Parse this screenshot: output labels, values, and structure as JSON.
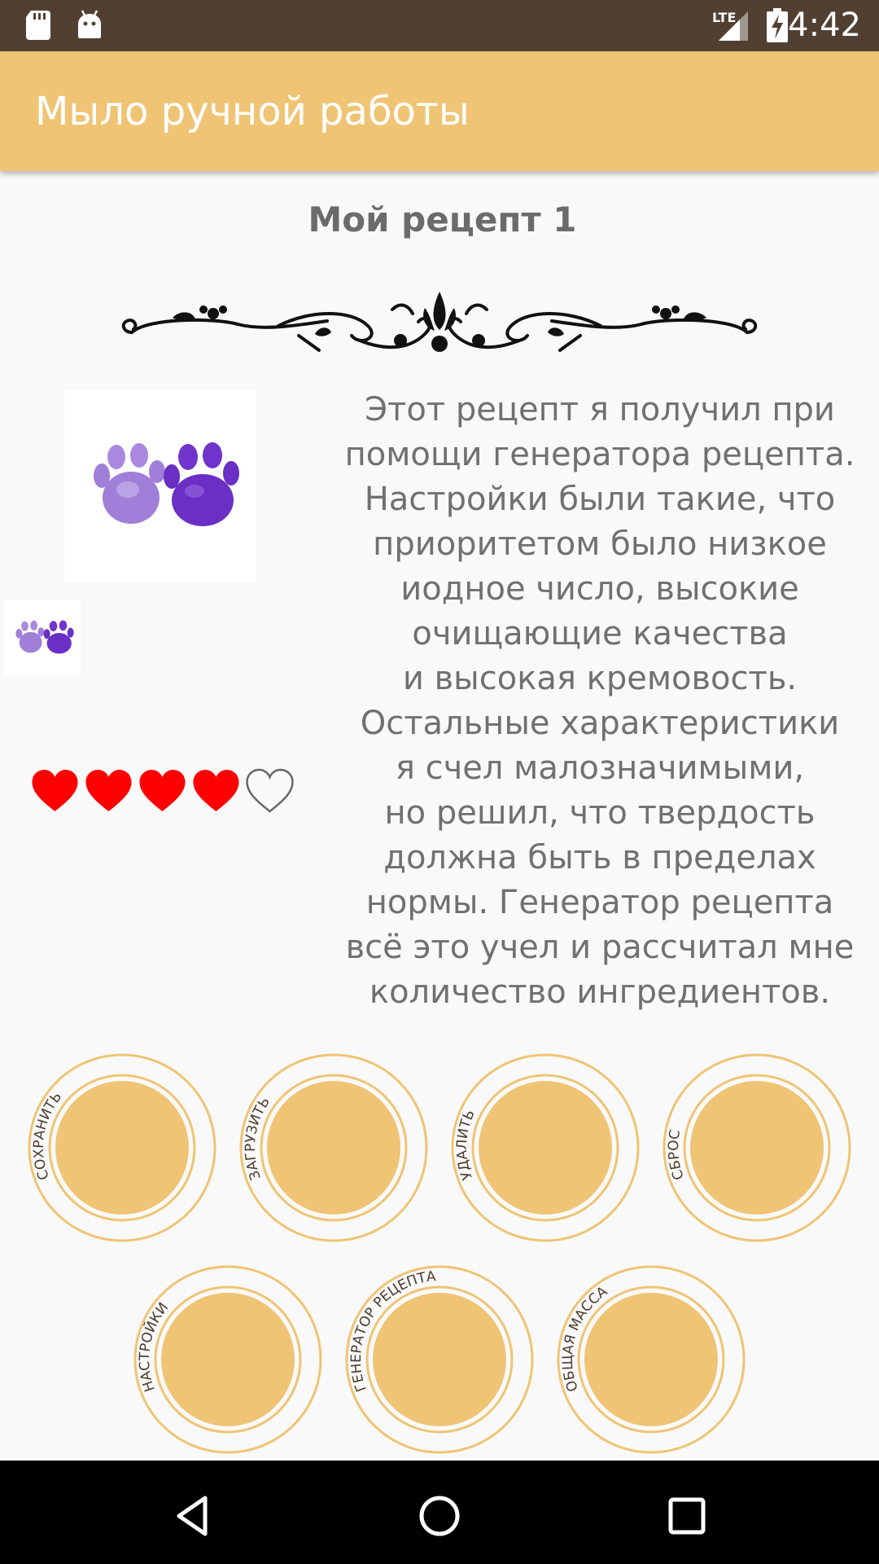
{
  "status_bar": {
    "network": "LTE",
    "time": "4:42"
  },
  "app_bar": {
    "title": "Мыло ручной работы"
  },
  "recipe": {
    "title": "Мой рецепт 1",
    "rating": 4,
    "rating_max": 5,
    "description": "Этот рецепт я получил при\nпомощи генератора рецепта.\nНастройки были такие, что\nприоритетом было низкое\nиодное число, высокие\nочищающие качества\nи высокая кремовость.\nОстальные характеристики\nя счел малозначимыми,\nно решил, что твердость\nдолжна быть в пределах\nнормы. Генератор рецепта\nвсё это учел и рассчитал мне\nколичество ингредиентов."
  },
  "buttons": {
    "save": "СОХРАНИТЬ",
    "load": "ЗАГРУЗИТЬ",
    "delete": "УДАЛИТЬ",
    "reset": "СБРОС",
    "settings": "НАСТРОЙКИ",
    "generator": "ГЕНЕРАТОР РЕЦЕПТА",
    "total_mass": "ОБЩАЯ МАССА"
  },
  "colors": {
    "accent": "#efc474",
    "status_bar": "#514032",
    "heart": "#ff0000",
    "soap_light": "#a07fd9",
    "soap_dark": "#6a2fc4"
  },
  "icons": [
    "sd-card-icon",
    "android-icon",
    "signal-icon",
    "battery-charging-icon",
    "back-icon",
    "home-icon",
    "recents-icon"
  ]
}
